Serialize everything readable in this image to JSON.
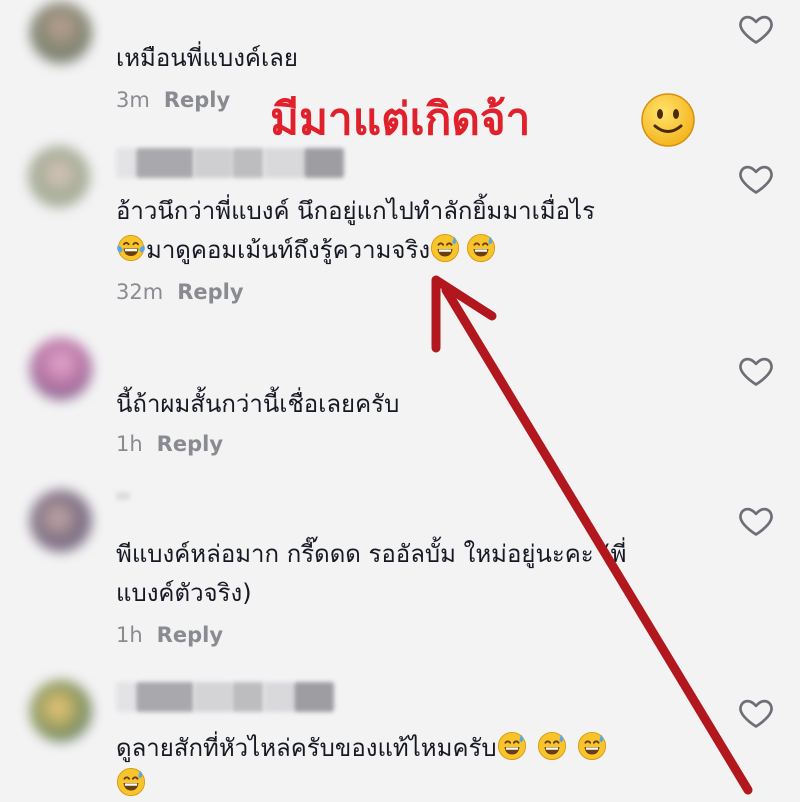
{
  "annotation": {
    "text": "มีมาแต่เกิดจ้า"
  },
  "reply_label": "Reply",
  "comments": [
    {
      "text": "เหมือนพี่แบงค์เลย",
      "time": "3m"
    },
    {
      "line1": "อ้าวนึกว่าพี่แบงค์ นึกอยู่แกไปทำลักยิ้มมาเมื่อไร",
      "line2": "มาดูคอมเม้นท์ถึงรู้ความจริง",
      "time": "32m"
    },
    {
      "text": "นี้ถ้าผมสั้นกว่านี้เชื่อเลยครับ",
      "time": "1h"
    },
    {
      "line1": "พีแบงค์หล่อมาก กรี๊ดดด รออัลบั้ม ใหม่อยู่นะคะ (พี่",
      "line2": "แบงค์ตัวจริง)",
      "time": "1h"
    },
    {
      "text": "ดูลายสักที่หัวไหล่ครับของแท้ไหมครับ"
    }
  ],
  "colors": {
    "annotation": "#e0202a",
    "arrow": "#b3171e",
    "meta": "#8a8b91",
    "text": "#161823"
  },
  "icons": {
    "like": "heart-outline-icon",
    "laugh": "face-tears-of-joy-icon",
    "sweat": "grinning-sweat-icon",
    "smile": "slightly-smiling-face-icon"
  }
}
